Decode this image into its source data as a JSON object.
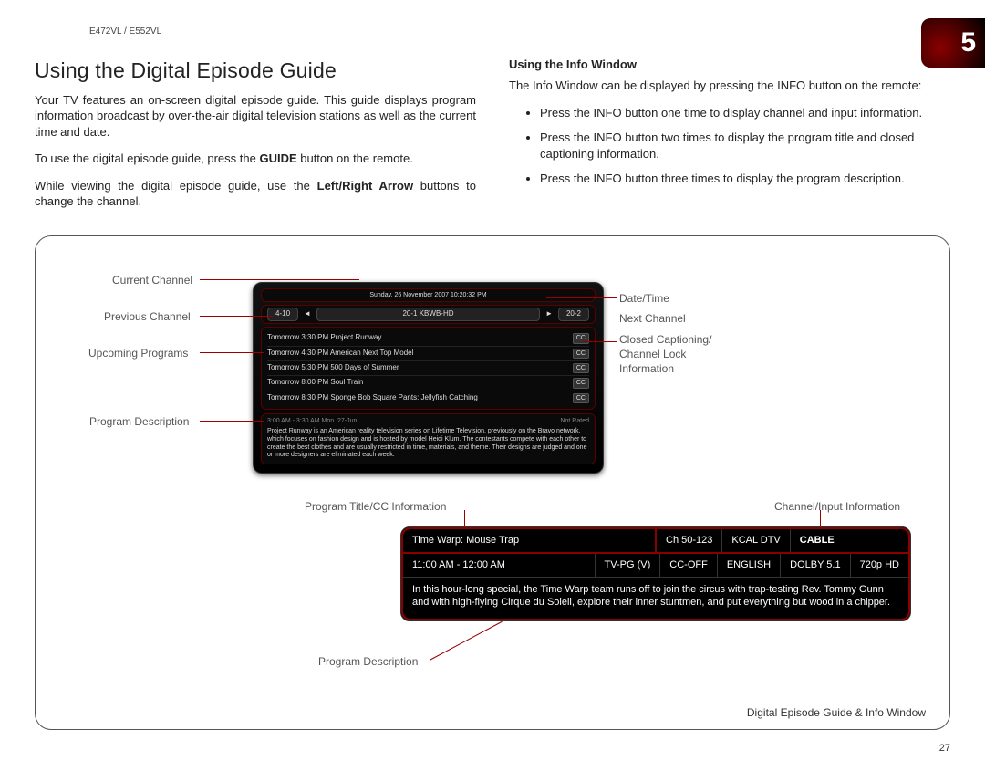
{
  "model_header": "E472VL / E552VL",
  "chapter_number": "5",
  "left": {
    "title": "Using the Digital Episode Guide",
    "p1": "Your TV features an on-screen digital episode guide. This guide displays program information broadcast by over-the-air digital television stations as well as the current time and date.",
    "p2_pre": "To use the digital episode guide, press the ",
    "p2_bold": "GUIDE",
    "p2_post": " button on the remote.",
    "p3_pre": "While viewing the digital episode guide, use the ",
    "p3_bold": "Left/Right Arrow",
    "p3_post": " buttons to change the channel."
  },
  "right": {
    "title": "Using the Info Window",
    "intro": "The Info Window can be displayed by pressing the INFO button on the remote:",
    "bullets": [
      "Press the INFO button one time to display channel and input information.",
      "Press the INFO button two times to display the program title and closed captioning information.",
      "Press the INFO button three times to display the program description."
    ]
  },
  "guide_callouts": {
    "current_channel": "Current Channel",
    "previous_channel": "Previous Channel",
    "upcoming_programs": "Upcoming Programs",
    "program_description": "Program Description",
    "date_time": "Date/Time",
    "next_channel": "Next Channel",
    "cc_lock_info": "Closed Captioning/\nChannel Lock\nInformation"
  },
  "info_callouts": {
    "title_cc": "Program Title/CC Information",
    "channel_input": "Channel/Input Information",
    "program_description": "Program Description"
  },
  "guide_osd": {
    "date": "Sunday, 26 November 2007 10:20:32 PM",
    "prev_ch_num": "4-10",
    "prev_arrow": "◄",
    "cur_ch": "20-1 KBWB-HD",
    "next_arrow": "►",
    "next_ch_num": "20-2",
    "items": [
      {
        "left": "Tomorrow   3:30 PM   Project Runway",
        "right": "CC"
      },
      {
        "left": "Tomorrow   4:30 PM   American Next Top Model",
        "right": "CC"
      },
      {
        "left": "Tomorrow   5:30 PM   500 Days of Summer",
        "right": "CC"
      },
      {
        "left": "Tomorrow   8:00 PM   Soul Train",
        "right": "CC"
      },
      {
        "left": "Tomorrow   8:30 PM   Sponge Bob Square Pants: Jellyfish Catching",
        "right": "CC"
      }
    ],
    "desc_time": "3:00 AM - 3:30 AM Mon. 27-Jun",
    "desc_rating": "Not Rated",
    "desc_text": "Project Runway is an American reality television series on Lifetime Television, previously on the Bravo network, which focuses on fashion design and is hosted by model Heidi Klum. The contestants compete with each other to create the best clothes and are usually restricted in time, materials, and theme. Their designs are judged and one or more designers are eliminated each week."
  },
  "info_osd": {
    "title": "Time Warp: Mouse Trap",
    "ch": "Ch 50-123",
    "station": "KCAL DTV",
    "source": "CABLE",
    "time": "11:00 AM - 12:00 AM",
    "rating": "TV-PG (V)",
    "cc": "CC-OFF",
    "lang": "ENGLISH",
    "audio": "DOLBY 5.1",
    "res": "720p HD",
    "desc": "In this hour-long special, the Time Warp team runs off to join the circus with trap-testing Rev. Tommy Gunn and with high-flying Cirque du Soleil, explore their inner stuntmen, and put everything but wood in a chipper."
  },
  "diagram_footer": "Digital Episode Guide & Info Window",
  "page_number": "27"
}
